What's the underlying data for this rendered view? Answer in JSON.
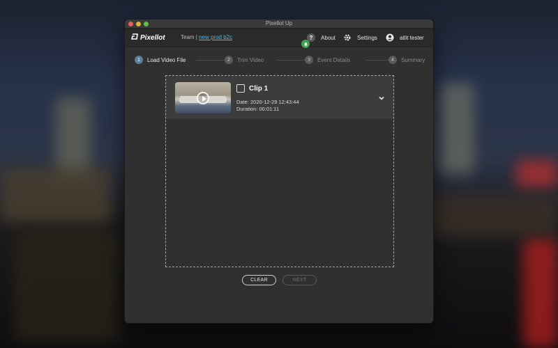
{
  "window": {
    "title": "Pixellot Up"
  },
  "appbar": {
    "logo_text": "Pixellot",
    "team_label": "Team | ",
    "team_link": "new prod b2c",
    "about_label": "About",
    "settings_label": "Settings",
    "user_label": "atlit tester"
  },
  "steps": [
    {
      "num": "1",
      "label": "Load Video File",
      "active": true
    },
    {
      "num": "2",
      "label": "Trim Video",
      "active": false
    },
    {
      "num": "3",
      "label": "Event Details",
      "active": false
    },
    {
      "num": "4",
      "label": "Summary",
      "active": false
    }
  ],
  "clip": {
    "title": "Clip 1",
    "date": "Date: 2020-12-29 12:43:44",
    "duration": "Duration: 00:01:11"
  },
  "buttons": {
    "clear": "CLEAR",
    "next": "NEXT"
  },
  "colors": {
    "accent": "#5fb3e6",
    "bell": "#3aa14c",
    "active_step": "#5b7f96"
  }
}
